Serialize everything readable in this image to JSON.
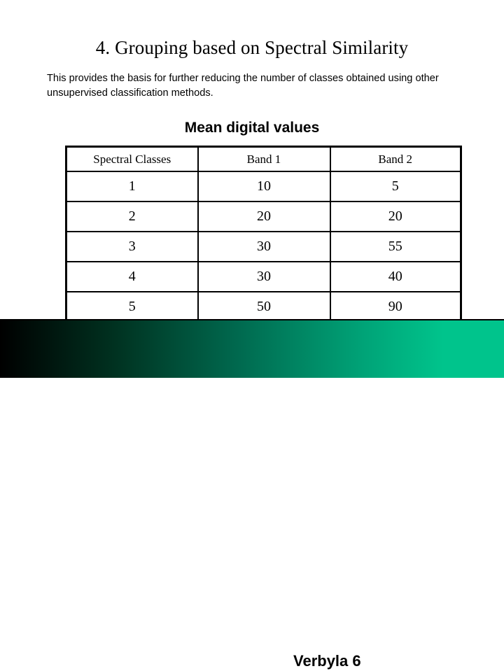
{
  "slide": {
    "title": "4. Grouping based on Spectral Similarity",
    "body_text": "This provides the basis for further reducing the number of classes obtained using other unsupervised classification methods.",
    "table_caption": "Mean digital values",
    "footer_label": "Verbyla 6",
    "colors": {
      "background": "#ffffff",
      "text": "#000000",
      "footer_gradient_start": "#000000",
      "footer_gradient_end": "#00c48c",
      "table_border": "#000000"
    }
  },
  "table": {
    "headers": [
      "Spectral Classes",
      "Band 1",
      "Band 2"
    ],
    "rows": [
      [
        "1",
        "10",
        "5"
      ],
      [
        "2",
        "20",
        "20"
      ],
      [
        "3",
        "30",
        "55"
      ],
      [
        "4",
        "30",
        "40"
      ],
      [
        "5",
        "50",
        "90"
      ]
    ]
  }
}
